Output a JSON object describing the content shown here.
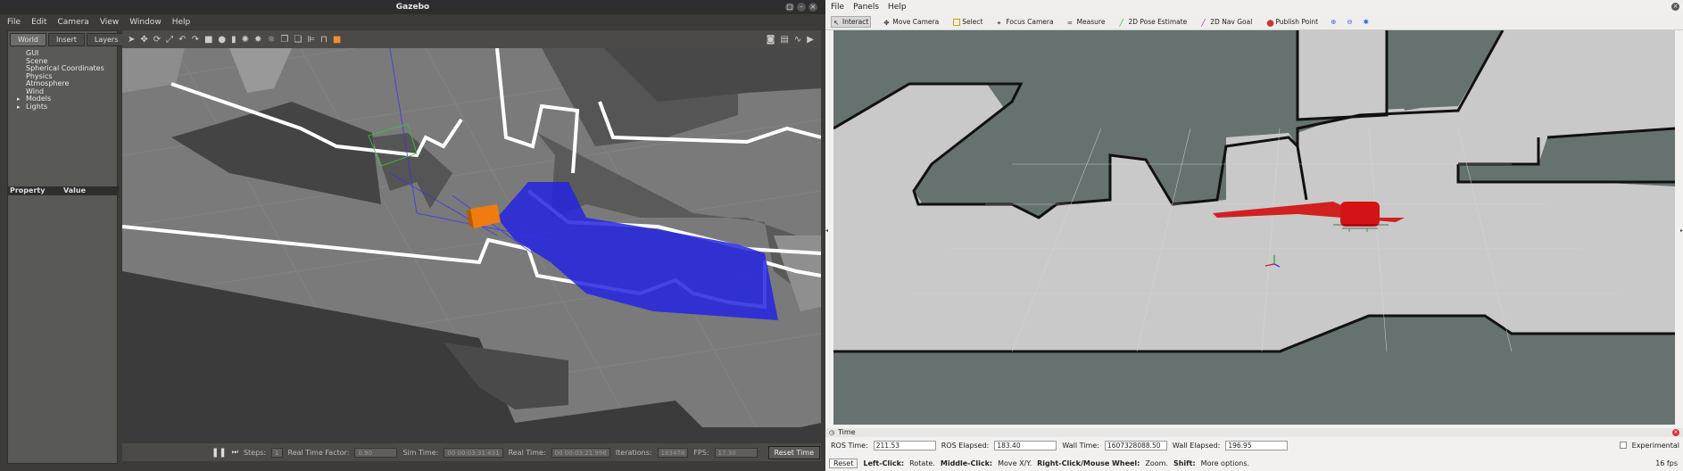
{
  "gazebo": {
    "title": "Gazebo",
    "menu": [
      "File",
      "Edit",
      "Camera",
      "View",
      "Window",
      "Help"
    ],
    "tabs": [
      "World",
      "Insert",
      "Layers"
    ],
    "tree": [
      {
        "label": "GUI",
        "expandable": false
      },
      {
        "label": "Scene",
        "expandable": false
      },
      {
        "label": "Spherical Coordinates",
        "expandable": false
      },
      {
        "label": "Physics",
        "expandable": false
      },
      {
        "label": "Atmosphere",
        "expandable": false
      },
      {
        "label": "Wind",
        "expandable": false
      },
      {
        "label": "Models",
        "expandable": true
      },
      {
        "label": "Lights",
        "expandable": true
      }
    ],
    "property_header": "Property",
    "value_header": "Value",
    "status": {
      "steps_label": "Steps:",
      "steps_value": "1",
      "rtf_label": "Real Time Factor:",
      "rtf_value": "0.90",
      "sim_time_label": "Sim Time:",
      "sim_time_value": "00 00:03:31.431",
      "real_time_label": "Real Time:",
      "real_time_value": "00 00:03:21.996",
      "iterations_label": "Iterations:",
      "iterations_value": "183478",
      "fps_label": "FPS:",
      "fps_value": "17.30",
      "reset_time": "Reset Time"
    }
  },
  "rviz": {
    "menu": [
      "File",
      "Panels",
      "Help"
    ],
    "tools": [
      {
        "label": "Interact",
        "icon": "pointer-icon",
        "active": true
      },
      {
        "label": "Move Camera",
        "icon": "camera-icon",
        "active": false
      },
      {
        "label": "Select",
        "icon": "select-icon",
        "active": false
      },
      {
        "label": "Focus Camera",
        "icon": "crosshair-icon",
        "active": false
      },
      {
        "label": "Measure",
        "icon": "ruler-icon",
        "active": false
      },
      {
        "label": "2D Pose Estimate",
        "icon": "green-arrow-icon",
        "active": false
      },
      {
        "label": "2D Nav Goal",
        "icon": "purple-arrow-icon",
        "active": false
      },
      {
        "label": "Publish Point",
        "icon": "pin-icon",
        "active": false
      }
    ],
    "time_panel_title": "Time",
    "ros_time_label": "ROS Time:",
    "ros_time_value": "211.53",
    "ros_elapsed_label": "ROS Elapsed:",
    "ros_elapsed_value": "183.40",
    "wall_time_label": "Wall Time:",
    "wall_time_value": "1607328088.50",
    "wall_elapsed_label": "Wall Elapsed:",
    "wall_elapsed_value": "196.95",
    "experimental_label": "Experimental",
    "reset_label": "Reset",
    "hint_1_bold": "Left-Click:",
    "hint_1": "Rotate.",
    "hint_2_bold": "Middle-Click:",
    "hint_2": "Move X/Y.",
    "hint_3_bold": "Right-Click/Mouse Wheel:",
    "hint_3": "Zoom.",
    "hint_4_bold": "Shift:",
    "hint_4": "More options.",
    "fps": "16 fps"
  }
}
